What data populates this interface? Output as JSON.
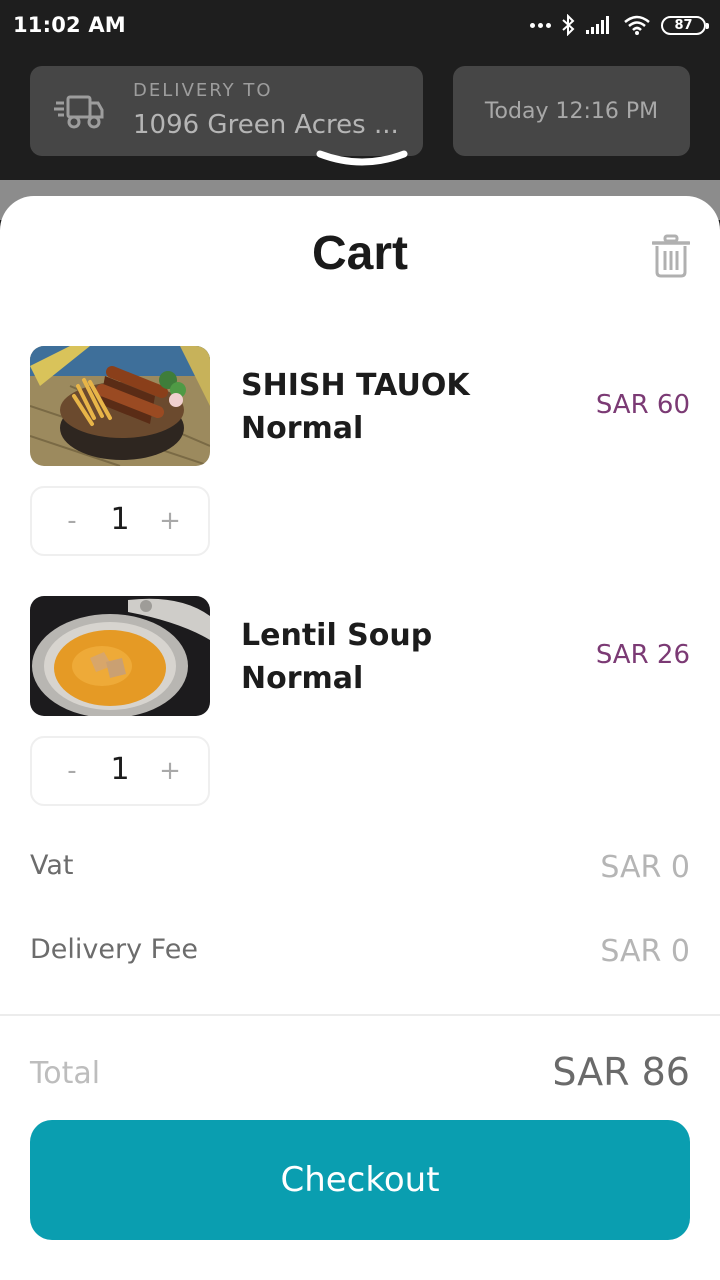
{
  "status_bar": {
    "time": "11:02 AM",
    "battery": "87"
  },
  "header": {
    "delivery_label": "DELIVERY TO",
    "delivery_address": "1096 Green Acres ...",
    "schedule": "Today 12:16 PM"
  },
  "cart": {
    "title": "Cart",
    "items": [
      {
        "name": "SHISH TAUOK",
        "variant": "Normal",
        "price": "SAR 60",
        "qty": "1",
        "minus": "-",
        "plus": "+"
      },
      {
        "name": "Lentil Soup",
        "variant": "Normal",
        "price": "SAR 26",
        "qty": "1",
        "minus": "-",
        "plus": "+"
      }
    ],
    "fees": [
      {
        "label": "Vat",
        "value": "SAR 0"
      },
      {
        "label": "Delivery Fee",
        "value": "SAR 0"
      }
    ],
    "total_label": "Total",
    "total_value": "SAR 86",
    "checkout_label": "Checkout"
  },
  "colors": {
    "price": "#7b3a74",
    "checkout": "#0a9eb0",
    "header_bg": "#1e1e1e",
    "header_box": "#464646"
  }
}
